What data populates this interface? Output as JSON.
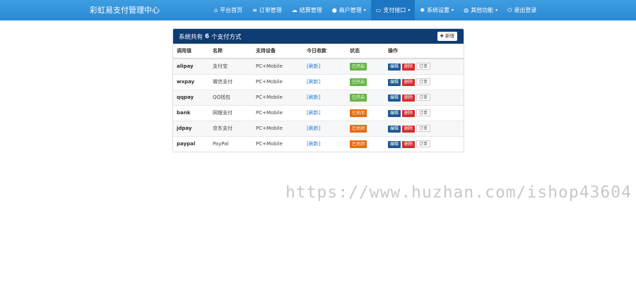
{
  "brand": "彩虹易支付管理中心",
  "nav": [
    {
      "label": "平台首页",
      "icon": "home-icon",
      "glyph": "⌂",
      "caret": false,
      "active": false
    },
    {
      "label": "订单管理",
      "icon": "list-icon",
      "glyph": "≡",
      "caret": false,
      "active": false
    },
    {
      "label": "结算管理",
      "icon": "cloud-icon",
      "glyph": "☁",
      "caret": false,
      "active": false
    },
    {
      "label": "商户管理",
      "icon": "user-icon",
      "glyph": "●",
      "caret": true,
      "active": false
    },
    {
      "label": "支付接口",
      "icon": "card-icon",
      "glyph": "▭",
      "caret": true,
      "active": true
    },
    {
      "label": "系统设置",
      "icon": "gear-icon",
      "glyph": "✱",
      "caret": true,
      "active": false
    },
    {
      "label": "其他功能",
      "icon": "globe-icon",
      "glyph": "◍",
      "caret": true,
      "active": false
    },
    {
      "label": "退出登录",
      "icon": "power-icon",
      "glyph": "⏻",
      "caret": false,
      "active": false
    }
  ],
  "panel": {
    "title_prefix": "系统共有",
    "count": "6",
    "title_suffix": "个支付方式",
    "add_label": "新增"
  },
  "table": {
    "headers": [
      "调用值",
      "名称",
      "支持设备",
      "今日收款",
      "状态",
      "操作"
    ],
    "rows": [
      {
        "code": "alipay",
        "name": "支付宝",
        "device": "PC+Mobile",
        "today": "[刷新]",
        "status": "已开启",
        "status_type": "on"
      },
      {
        "code": "wxpay",
        "name": "微信支付",
        "device": "PC+Mobile",
        "today": "[刷新]",
        "status": "已开启",
        "status_type": "on"
      },
      {
        "code": "qqpay",
        "name": "QQ钱包",
        "device": "PC+Mobile",
        "today": "[刷新]",
        "status": "已开启",
        "status_type": "on"
      },
      {
        "code": "bank",
        "name": "网银支付",
        "device": "PC+Mobile",
        "today": "[刷新]",
        "status": "已关闭",
        "status_type": "off"
      },
      {
        "code": "jdpay",
        "name": "京东支付",
        "device": "PC+Mobile",
        "today": "[刷新]",
        "status": "已关闭",
        "status_type": "off"
      },
      {
        "code": "paypal",
        "name": "PayPal",
        "device": "PC+Mobile",
        "today": "[刷新]",
        "status": "已关闭",
        "status_type": "off"
      }
    ],
    "actions": {
      "edit": "编辑",
      "delete": "删除",
      "orders": "订单"
    }
  },
  "watermark": "https://www.huzhan.com/ishop43604"
}
